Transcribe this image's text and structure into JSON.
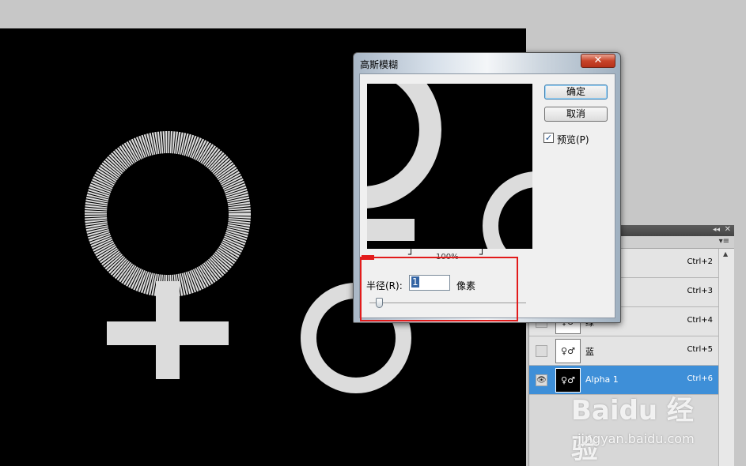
{
  "dialog": {
    "title": "高斯模糊",
    "close_label": "✕",
    "ok_label": "确定",
    "cancel_label": "取消",
    "preview_checkbox_label": "预览(P)",
    "preview_checked": true,
    "zoom_level": "100%",
    "zoom_out_symbol": "⌐",
    "zoom_in_symbol": "⌐",
    "radius_label": "半径(R):",
    "radius_value": "1",
    "radius_unit": "像素",
    "radius_slider_fraction": 0.04
  },
  "channels_panel": {
    "channels": [
      {
        "name": "",
        "shortcut": "Ctrl+2",
        "thumb": "",
        "visible": false,
        "selected": false
      },
      {
        "name": "",
        "shortcut": "Ctrl+3",
        "thumb": "",
        "visible": false,
        "selected": false
      },
      {
        "name": "绿",
        "shortcut": "Ctrl+4",
        "thumb": "♀♂",
        "visible": false,
        "selected": false
      },
      {
        "name": "蓝",
        "shortcut": "Ctrl+5",
        "thumb": "♀♂",
        "visible": false,
        "selected": false
      },
      {
        "name": "Alpha 1",
        "shortcut": "Ctrl+6",
        "thumb": "♀♂",
        "visible": true,
        "selected": true
      }
    ]
  },
  "watermark": {
    "logo_text": "Baidu 经验",
    "url": "jingyan.baidu.com"
  },
  "colors": {
    "canvas_background": "#000000",
    "symbol_fill": "#dcdcdc",
    "selection_highlight": "#3e8fd8",
    "annotation_red": "#e21b1b"
  }
}
